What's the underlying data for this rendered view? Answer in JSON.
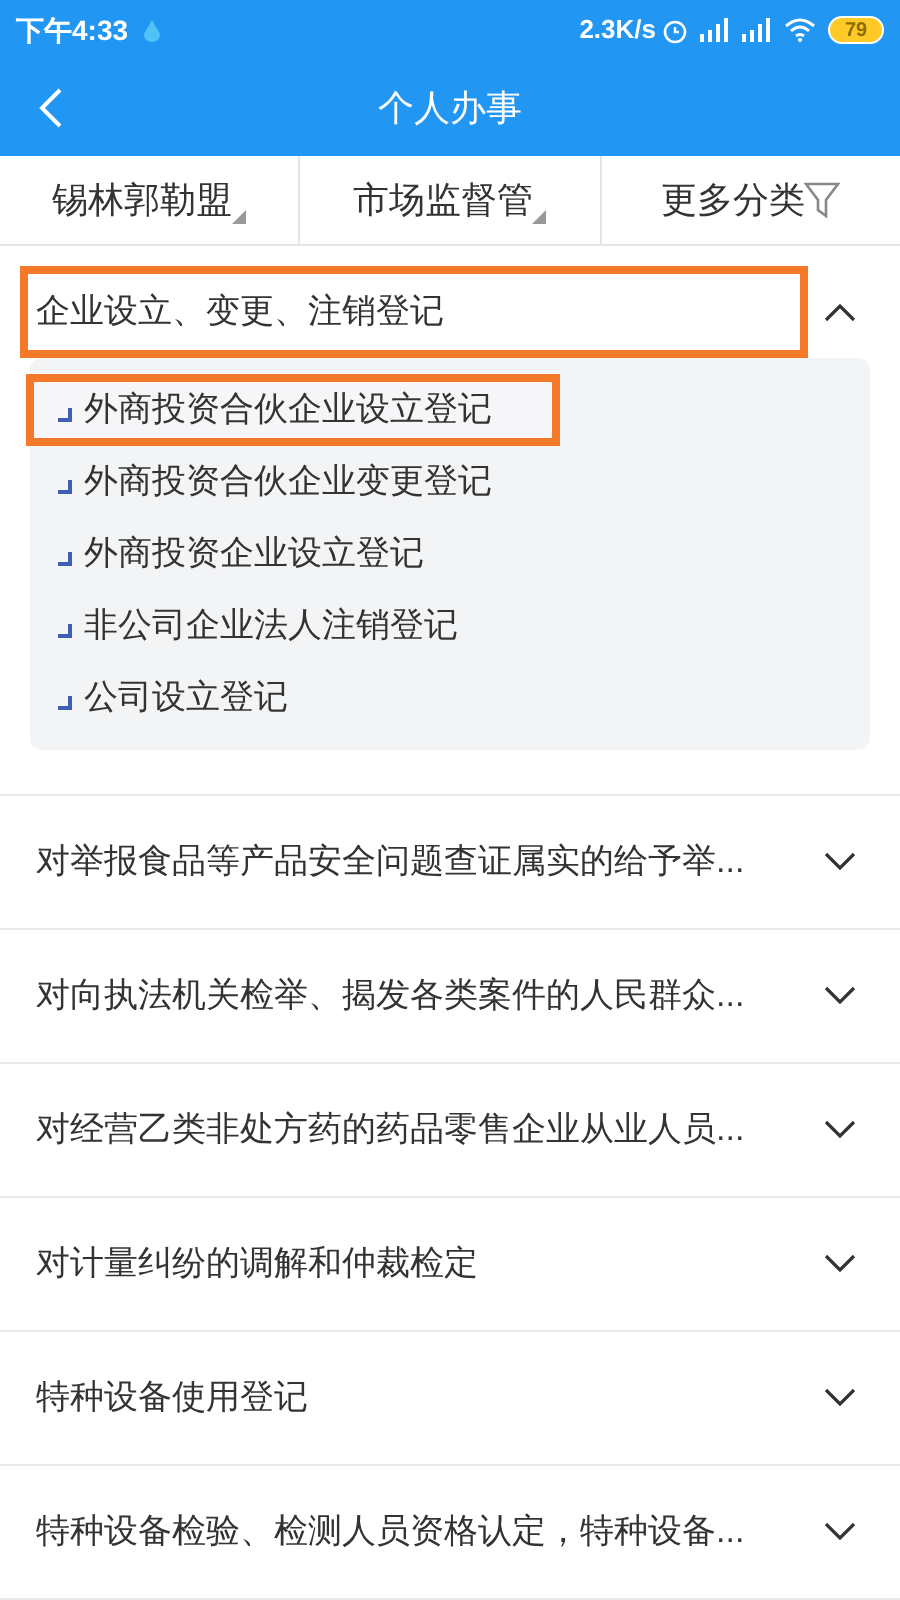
{
  "status_bar": {
    "time": "下午4:33",
    "speed": "2.3K/s",
    "battery": "79"
  },
  "header": {
    "title": "个人办事"
  },
  "filters": [
    {
      "label": "锡林郭勒盟",
      "kind": "dropdown"
    },
    {
      "label": "市场监督管",
      "kind": "dropdown"
    },
    {
      "label": "更多分类",
      "kind": "filter"
    }
  ],
  "sections": [
    {
      "title": "企业设立、变更、注销登记",
      "expanded": true,
      "highlighted": true,
      "items": [
        {
          "label": "外商投资合伙企业设立登记",
          "highlighted": true
        },
        {
          "label": "外商投资合伙企业变更登记",
          "highlighted": false
        },
        {
          "label": "外商投资企业设立登记",
          "highlighted": false
        },
        {
          "label": "非公司企业法人注销登记",
          "highlighted": false
        },
        {
          "label": "公司设立登记",
          "highlighted": false
        }
      ]
    },
    {
      "title": "对举报食品等产品安全问题查证属实的给予举...",
      "expanded": false,
      "highlighted": false
    },
    {
      "title": "对向执法机关检举、揭发各类案件的人民群众...",
      "expanded": false,
      "highlighted": false
    },
    {
      "title": "对经营乙类非处方药的药品零售企业从业人员...",
      "expanded": false,
      "highlighted": false
    },
    {
      "title": "对计量纠纷的调解和仲裁检定",
      "expanded": false,
      "highlighted": false
    },
    {
      "title": "特种设备使用登记",
      "expanded": false,
      "highlighted": false
    },
    {
      "title": "特种设备检验、检测人员资格认定，特种设备...",
      "expanded": false,
      "highlighted": false
    }
  ]
}
